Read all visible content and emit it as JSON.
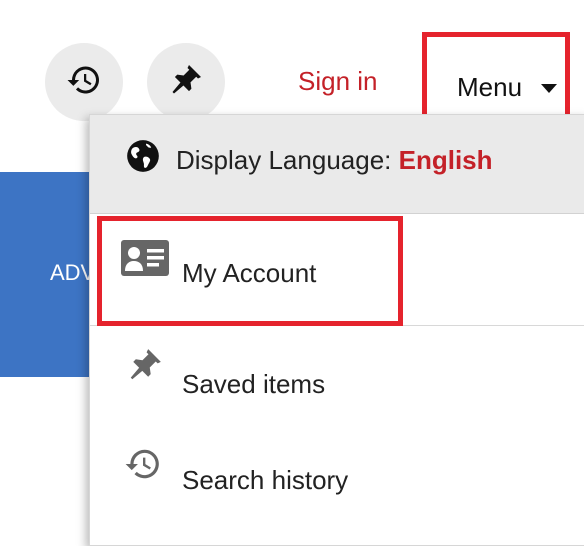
{
  "header": {
    "history_icon": "history-icon",
    "pin_icon": "pin-icon",
    "signin_label": "Sign in",
    "menu_label": "Menu"
  },
  "left_panel": {
    "text": "ADV"
  },
  "menu": {
    "language_label": "Display Language: ",
    "language_value": "English",
    "items": [
      {
        "label": "My Account",
        "icon": "account-card-icon"
      },
      {
        "label": "Saved items",
        "icon": "pin-icon"
      },
      {
        "label": "Search history",
        "icon": "history-icon"
      }
    ]
  },
  "colors": {
    "accent_red": "#c42128",
    "highlight_red": "#e5232d",
    "panel_blue": "#3d74c4",
    "icon_gray": "#666666"
  }
}
